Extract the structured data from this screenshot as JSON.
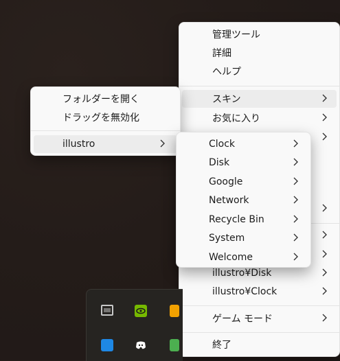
{
  "main_menu": {
    "items": [
      {
        "label": "管理ツール"
      },
      {
        "label": "詳細"
      },
      {
        "label": "ヘルプ"
      },
      {
        "label": "スキン",
        "submenu": true,
        "highlighted": true
      },
      {
        "label": "お気に入り",
        "submenu": true
      },
      {
        "label": "",
        "submenu": true
      },
      {
        "label": ""
      },
      {
        "label": ""
      },
      {
        "label": "",
        "submenu": true
      },
      {
        "label": "",
        "submenu": true
      },
      {
        "label": "",
        "submenu": true
      },
      {
        "label": "illustro¥Disk",
        "submenu": true
      },
      {
        "label": "illustro¥Clock",
        "submenu": true
      },
      {
        "label": "ゲーム モード",
        "submenu": true
      },
      {
        "label": "終了"
      }
    ]
  },
  "left_submenu": {
    "items": [
      {
        "label": "フォルダーを開く"
      },
      {
        "label": "ドラッグを無効化"
      },
      {
        "label": "illustro",
        "submenu": true,
        "highlighted": true
      }
    ]
  },
  "skins_submenu": {
    "items": [
      {
        "label": "Clock"
      },
      {
        "label": "Disk"
      },
      {
        "label": "Google"
      },
      {
        "label": "Network"
      },
      {
        "label": "Recycle Bin"
      },
      {
        "label": "System"
      },
      {
        "label": "Welcome"
      }
    ]
  },
  "tray": {
    "icons": [
      {
        "icon": "monitor-meter-icon",
        "color": "#c8c8c8"
      },
      {
        "icon": "nvidia-icon",
        "color": "#76b900"
      },
      {
        "icon": "app-orange-icon",
        "color": "#f2a100"
      },
      {
        "icon": "blue-app-icon",
        "color": "#1e88e5"
      },
      {
        "icon": "discord-icon",
        "color": "#ffffff"
      },
      {
        "icon": "green-app-icon",
        "color": "#4caf50"
      }
    ]
  }
}
